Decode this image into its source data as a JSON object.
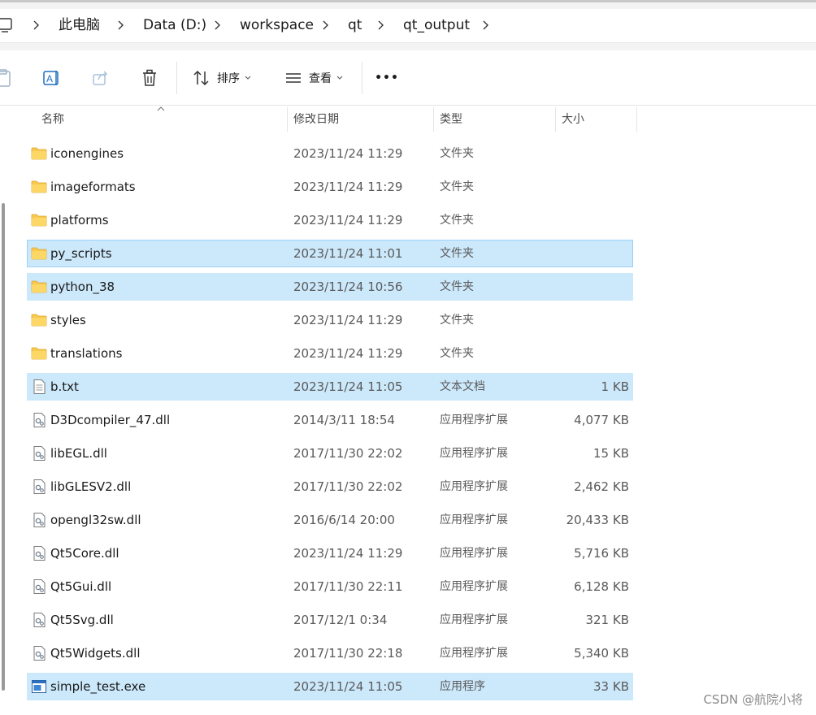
{
  "breadcrumb": [
    "此电脑",
    "Data (D:)",
    "workspace",
    "qt",
    "qt_output"
  ],
  "toolbar": {
    "sort_label": "排序",
    "view_label": "查看",
    "more_label": "•••"
  },
  "columns": {
    "name": "名称",
    "date": "修改日期",
    "type": "类型",
    "size": "大小"
  },
  "files": [
    {
      "name": "iconengines",
      "date": "2023/11/24 11:29",
      "type": "文件夹",
      "size": "",
      "kind": "folder",
      "selected": false
    },
    {
      "name": "imageformats",
      "date": "2023/11/24 11:29",
      "type": "文件夹",
      "size": "",
      "kind": "folder",
      "selected": false
    },
    {
      "name": "platforms",
      "date": "2023/11/24 11:29",
      "type": "文件夹",
      "size": "",
      "kind": "folder",
      "selected": false
    },
    {
      "name": "py_scripts",
      "date": "2023/11/24 11:01",
      "type": "文件夹",
      "size": "",
      "kind": "folder",
      "selected": true,
      "focused": true
    },
    {
      "name": "python_38",
      "date": "2023/11/24 10:56",
      "type": "文件夹",
      "size": "",
      "kind": "folder",
      "selected": true
    },
    {
      "name": "styles",
      "date": "2023/11/24 11:29",
      "type": "文件夹",
      "size": "",
      "kind": "folder",
      "selected": false
    },
    {
      "name": "translations",
      "date": "2023/11/24 11:29",
      "type": "文件夹",
      "size": "",
      "kind": "folder",
      "selected": false
    },
    {
      "name": "b.txt",
      "date": "2023/11/24 11:05",
      "type": "文本文档",
      "size": "1 KB",
      "kind": "text",
      "selected": true
    },
    {
      "name": "D3Dcompiler_47.dll",
      "date": "2014/3/11 18:54",
      "type": "应用程序扩展",
      "size": "4,077 KB",
      "kind": "dll",
      "selected": false
    },
    {
      "name": "libEGL.dll",
      "date": "2017/11/30 22:02",
      "type": "应用程序扩展",
      "size": "15 KB",
      "kind": "dll",
      "selected": false
    },
    {
      "name": "libGLESV2.dll",
      "date": "2017/11/30 22:02",
      "type": "应用程序扩展",
      "size": "2,462 KB",
      "kind": "dll",
      "selected": false
    },
    {
      "name": "opengl32sw.dll",
      "date": "2016/6/14 20:00",
      "type": "应用程序扩展",
      "size": "20,433 KB",
      "kind": "dll",
      "selected": false
    },
    {
      "name": "Qt5Core.dll",
      "date": "2023/11/24 11:29",
      "type": "应用程序扩展",
      "size": "5,716 KB",
      "kind": "dll",
      "selected": false
    },
    {
      "name": "Qt5Gui.dll",
      "date": "2017/11/30 22:11",
      "type": "应用程序扩展",
      "size": "6,128 KB",
      "kind": "dll",
      "selected": false
    },
    {
      "name": "Qt5Svg.dll",
      "date": "2017/12/1 0:34",
      "type": "应用程序扩展",
      "size": "321 KB",
      "kind": "dll",
      "selected": false
    },
    {
      "name": "Qt5Widgets.dll",
      "date": "2017/11/30 22:18",
      "type": "应用程序扩展",
      "size": "5,340 KB",
      "kind": "dll",
      "selected": false
    },
    {
      "name": "simple_test.exe",
      "date": "2023/11/24 11:05",
      "type": "应用程序",
      "size": "33 KB",
      "kind": "exe",
      "selected": true
    }
  ],
  "watermark": "CSDN @航院小将",
  "colors": {
    "selection": "#cce8fb",
    "selection_border": "#99d1f7",
    "folder": "#f8c850",
    "toolbar_icon": "#1e6fbf"
  }
}
